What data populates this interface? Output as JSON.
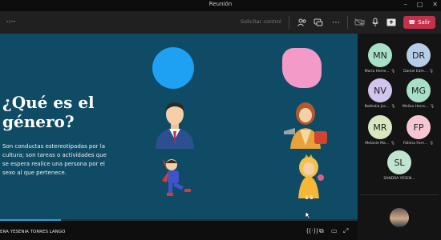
{
  "window": {
    "title": "Reunión"
  },
  "toolbar": {
    "timer": "-:--",
    "request_control": "Solicitar control",
    "leave_label": "Salir"
  },
  "slide": {
    "heading_line1": "¿Qué es el",
    "heading_line2": "género?",
    "body": "Son conductas estereotipadas por la cultura; son tareas o actividades que se espera realice una persona por el sexo al que pertenece.",
    "progress": 0.17,
    "colors": {
      "blue_circle": "#1ea0f3",
      "pink_blob": "#f39ac8",
      "background": "#0f4b64"
    }
  },
  "presenter": {
    "name": "ERA YESENIA TORRES LANGO"
  },
  "participants": [
    {
      "initials": "MN",
      "name": "Maria Herre...",
      "color": "#a7e0c6"
    },
    {
      "initials": "DR",
      "name": "Daniel Edm...",
      "color": "#b6cde8"
    },
    {
      "initials": "NV",
      "name": "Nathalia Joc...",
      "color": "#d2c4ec"
    },
    {
      "initials": "MG",
      "name": "Melisa Herre...",
      "color": "#a7e0c6"
    },
    {
      "initials": "MR",
      "name": "Melanie Ma...",
      "color": "#d9e7c0"
    },
    {
      "initials": "FP",
      "name": "Fátima Fern...",
      "color": "#f6c6d3"
    },
    {
      "initials": "SL",
      "name": "SANDRA YESEN...",
      "color": "#bfe5d1"
    }
  ]
}
